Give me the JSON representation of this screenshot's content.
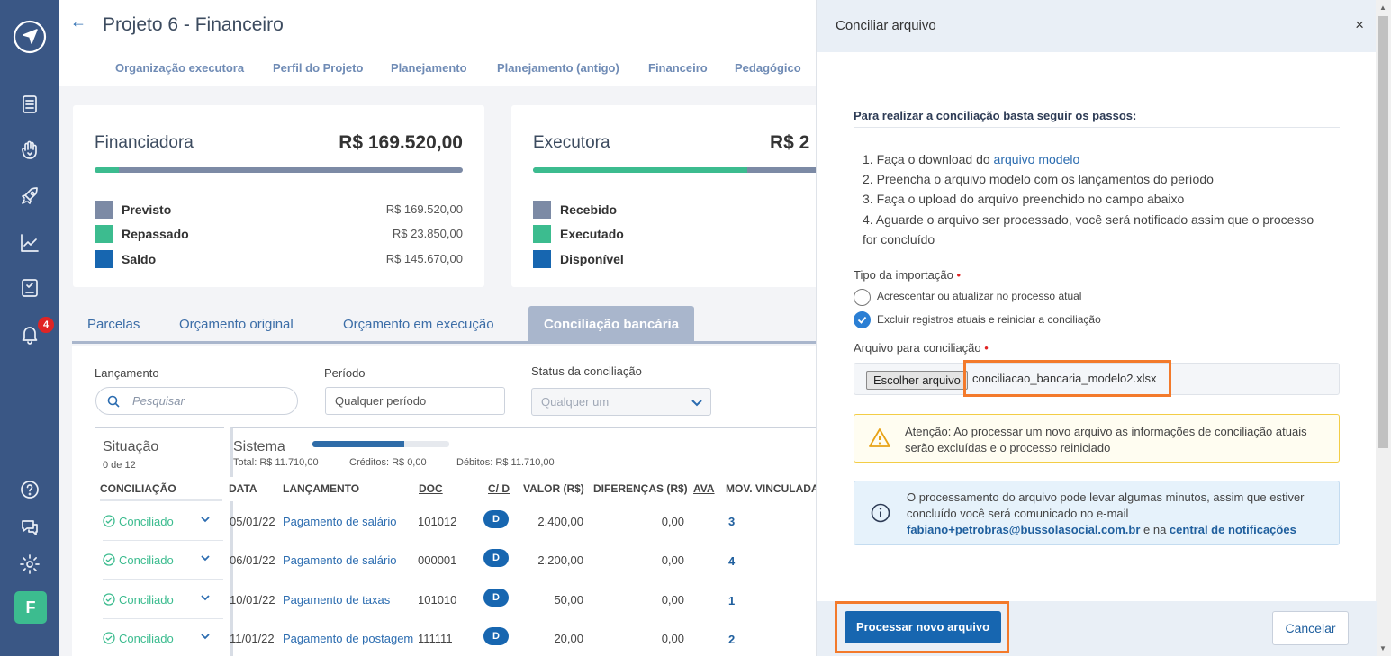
{
  "sidebar": {
    "icons": [
      "logo-icon",
      "document-icon",
      "hand-icon",
      "rocket-icon",
      "chart-icon",
      "report-icon",
      "bell-icon",
      "help-icon",
      "chat-icon",
      "gear-icon"
    ],
    "notifications_count": "4",
    "user_initial": "F"
  },
  "header": {
    "title": "Projeto 6 - Financeiro",
    "tabs": [
      "Organização executora",
      "Perfil do Projeto",
      "Planejamento",
      "Planejamento (antigo)",
      "Financeiro",
      "Pedagógico"
    ]
  },
  "financiadora": {
    "title": "Financiadora",
    "amount": "R$ 169.520,00",
    "progress": 0.065,
    "rows": [
      {
        "label": "Previsto",
        "value": "R$ 169.520,00",
        "color": "#7c8aa5"
      },
      {
        "label": "Repassado",
        "value": "R$ 23.850,00",
        "color": "#3cbc8f"
      },
      {
        "label": "Saldo",
        "value": "R$ 145.670,00",
        "color": "#1766b0"
      }
    ]
  },
  "executora": {
    "title": "Executora",
    "amount": "R$ 2",
    "progress": 0.6,
    "rows": [
      {
        "label": "Recebido",
        "color": "#7c8aa5"
      },
      {
        "label": "Executado",
        "color": "#3cbc8f"
      },
      {
        "label": "Disponível",
        "color": "#1766b0"
      }
    ]
  },
  "content_tabs": [
    "Parcelas",
    "Orçamento original",
    "Orçamento em execução",
    "Conciliação bancária"
  ],
  "filters": {
    "lancamento_label": "Lançamento",
    "search_placeholder": "Pesquisar",
    "periodo_label": "Período",
    "periodo_value": "Qualquer período",
    "status_label": "Status da conciliação",
    "status_value": "Qualquer um"
  },
  "situacao": {
    "title": "Situação",
    "count": "0 de 12",
    "col": "CONCILIAÇÃO"
  },
  "sistema": {
    "title": "Sistema",
    "progress": 0.67,
    "total": "Total: R$ 11.710,00",
    "creditos": "Créditos: R$ 0,00",
    "debitos": "Débitos: R$ 11.710,00",
    "columns": [
      "DATA",
      "LANÇAMENTO",
      "DOC",
      "C/ D",
      "VALOR (R$)",
      "DIFERENÇAS (R$)",
      "AVA",
      "MOV. VINCULADA"
    ]
  },
  "rows": [
    {
      "status": "Conciliado",
      "date": "05/01/22",
      "desc": "Pagamento de salário",
      "doc": "101012",
      "cd": "D",
      "valor": "2.400,00",
      "dif": "0,00",
      "mov": "3"
    },
    {
      "status": "Conciliado",
      "date": "06/01/22",
      "desc": "Pagamento de salário",
      "doc": "000001",
      "cd": "D",
      "valor": "2.200,00",
      "dif": "0,00",
      "mov": "4"
    },
    {
      "status": "Conciliado",
      "date": "10/01/22",
      "desc": "Pagamento de taxas",
      "doc": "101010",
      "cd": "D",
      "valor": "50,00",
      "dif": "0,00",
      "mov": "1"
    },
    {
      "status": "Conciliado",
      "date": "11/01/22",
      "desc": "Pagamento de postagem",
      "doc": "111111",
      "cd": "D",
      "valor": "20,00",
      "dif": "0,00",
      "mov": "2"
    }
  ],
  "panel": {
    "title": "Conciliar arquivo",
    "close": "×",
    "steps_title": "Para realizar a conciliação basta seguir os passos:",
    "step1_prefix": "1. Faça o download do ",
    "step1_link": "arquivo modelo",
    "step2": "2. Preencha o arquivo modelo com os lançamentos do período",
    "step3": "3. Faça o upload do arquivo preenchido no campo abaixo",
    "step4a": "4. Aguarde o arquivo ser processado, você será notificado assim que o processo",
    "step4b": "for concluído",
    "tipo_label": "Tipo da importação",
    "required_mark": "•",
    "option1": "Acrescentar ou atualizar no processo atual",
    "option2": "Excluir registros atuais e reiniciar a conciliação",
    "arquivo_label": "Arquivo para conciliação",
    "file_button": "Escolher arquivo",
    "file_name": "conciliacao_bancaria_modelo2.xlsx",
    "warning_text": "Atenção: Ao processar um novo arquivo as informações de conciliação atuais serão excluídas e o processo reiniciado",
    "info_text": "O processamento do arquivo pode levar algumas minutos, assim que estiver concluído você será comunicado no e-mail",
    "info_email": "fabiano+petrobras@bussolasocial.com.br",
    "info_mid": " e na ",
    "info_link": "central de notificações",
    "btn_process": "Processar novo arquivo",
    "btn_cancel": "Cancelar"
  }
}
